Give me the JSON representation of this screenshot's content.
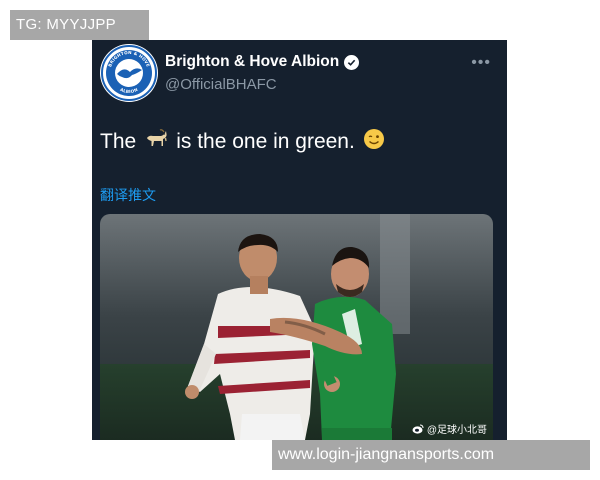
{
  "overlay": {
    "tg_label": "TG: MYYJJPP",
    "url_label": "www.login-jiangnansports.com"
  },
  "tweet": {
    "display_name": "Brighton & Hove Albion",
    "handle": "@OfficialBHAFC",
    "verified": true,
    "text_before": "The",
    "text_after": "is the one in green.",
    "emoji_goat": "goat-icon",
    "emoji_wink": "winking-face-icon",
    "translate_label": "翻译推文",
    "more_icon": "more-dots-icon",
    "avatar_logo": {
      "top_text": "BRIGHTON & HOVE",
      "bottom_text": "ALBION"
    },
    "photo": {
      "watermark": "@足球小北哥",
      "watermark_icon": "weibo-icon"
    }
  },
  "colors": {
    "tweet_bg": "#15202e",
    "link_blue": "#1d9bf0",
    "handle_gray": "#8b98a5",
    "overlay_gray": "#a7a7a7",
    "bha_blue": "#1b61b5"
  }
}
